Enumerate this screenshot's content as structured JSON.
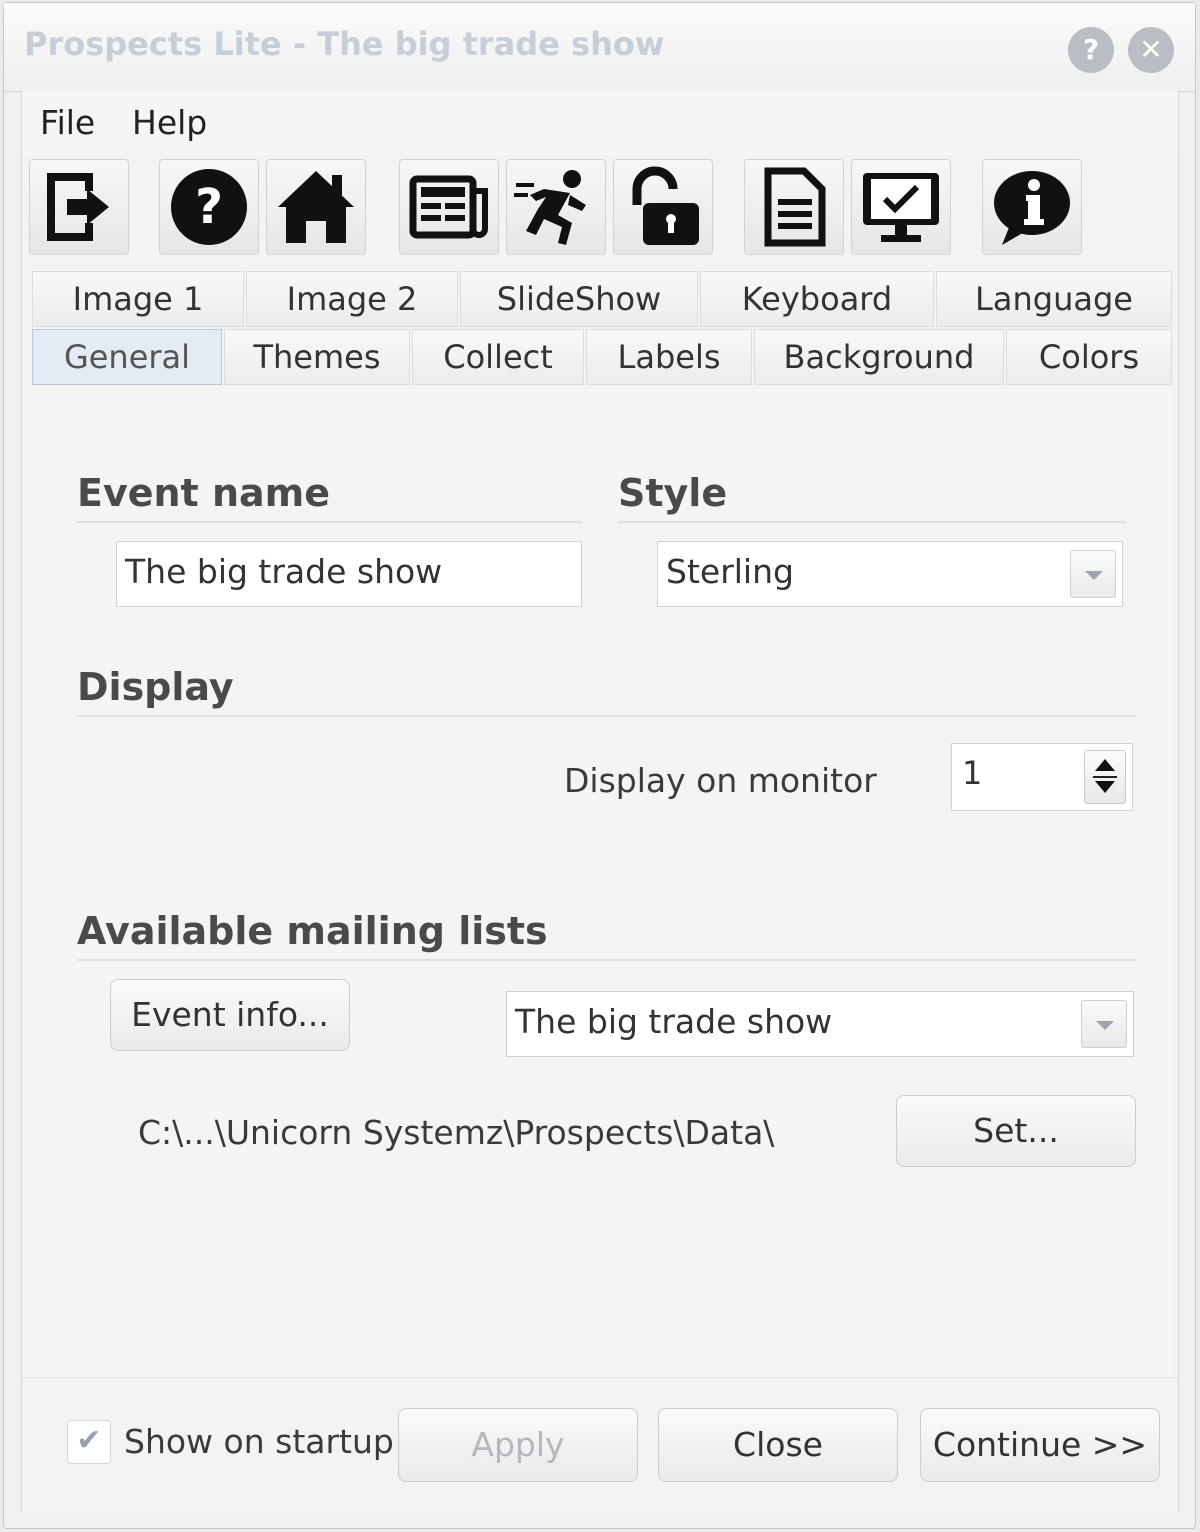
{
  "window": {
    "title": "Prospects Lite - The big trade show",
    "help_glyph": "?",
    "close_glyph": "✕"
  },
  "menu": {
    "items": [
      "File",
      "Help"
    ]
  },
  "toolbar": {
    "icons": [
      "exit-icon",
      "help-icon",
      "home-icon",
      "news-icon",
      "runner-icon",
      "unlock-icon",
      "document-icon",
      "monitor-check-icon",
      "info-bubble-icon"
    ]
  },
  "tabs": {
    "row1": [
      "Image 1",
      "Image 2",
      "SlideShow",
      "Keyboard",
      "Language"
    ],
    "row2": [
      "General",
      "Themes",
      "Collect",
      "Labels",
      "Background",
      "Colors"
    ],
    "active": "General"
  },
  "general": {
    "event_name_title": "Event name",
    "event_name_value": "The big trade show",
    "style_title": "Style",
    "style_value": "Sterling",
    "display_title": "Display",
    "display_monitor_label": "Display on monitor",
    "display_monitor_value": "1",
    "mailing_title": "Available mailing lists",
    "event_info_button": "Event info...",
    "mailing_list_value": "The big trade show",
    "data_path": "C:\\...\\Unicorn Systemz\\Prospects\\Data\\",
    "set_button": "Set..."
  },
  "footer": {
    "show_on_startup_label": "Show on startup",
    "show_on_startup_checked": "✔",
    "apply_button": "Apply",
    "close_button": "Close",
    "continue_button": "Continue >>"
  },
  "colors": {
    "title_text": "#c6ced8",
    "active_tab": "#e3ecf5",
    "disabled_text": "#b4b8bd"
  }
}
